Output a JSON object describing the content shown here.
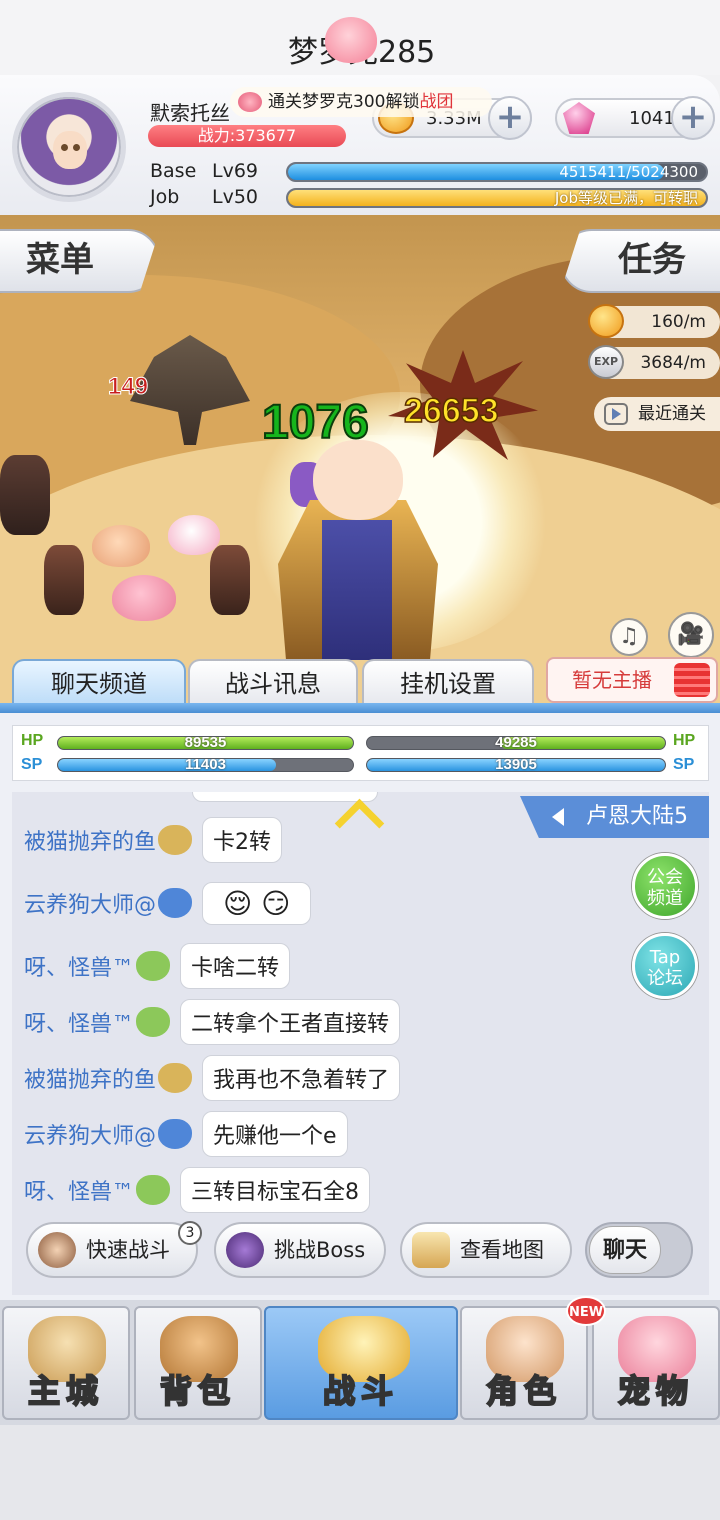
{
  "player": {
    "name": "默索托丝",
    "power": "战力:373677",
    "base_label": "Base",
    "base_level": "Lv69",
    "base_exp": "4515411/5024300",
    "base_exp_fraction": 0.899,
    "job_label": "Job",
    "job_level": "Lv50",
    "job_status": "Job等级已满，可转职",
    "job_exp_fraction": 1.0
  },
  "currency": {
    "zeny": "3.33M",
    "gems": "1041",
    "plus": "+"
  },
  "scene": {
    "menu": "菜单",
    "task": "任务",
    "stage_title": "梦罗克285",
    "unlock_text": "通关梦罗克300解锁",
    "unlock_highlight": "战团",
    "zeny_rate": "160/m",
    "exp_rate": "3684/m",
    "exp_badge": "EXP",
    "recent_clear": "最近通关",
    "damage_player": "1076",
    "damage_crit": "26653",
    "damage_enemy": "149"
  },
  "tabs": [
    {
      "label": "聊天频道",
      "active": true
    },
    {
      "label": "战斗讯息",
      "active": false
    },
    {
      "label": "挂机设置",
      "active": false
    }
  ],
  "broadcast": "暂无主播",
  "stats": {
    "hp_label": "HP",
    "sp_label": "SP",
    "player_hp": "89535",
    "player_hp_fraction": 1.0,
    "player_sp": "11403",
    "player_sp_fraction": 0.74,
    "pet_hp": "49285",
    "pet_hp_fraction": 0.55,
    "pet_sp": "13905",
    "pet_sp_fraction": 1.0
  },
  "chat": {
    "region": "卢恩大陆5",
    "guild_channel": "公会\n频道",
    "tap_forum": "Tap\n论坛",
    "messages": [
      {
        "user": "被猫抛弃的鱼",
        "text": "卡2转",
        "badge_color": "#d9b45a"
      },
      {
        "user": "云养狗大师@",
        "text": "😌  😏",
        "badge_color": "#4f86d8"
      },
      {
        "user": "呀、怪兽™",
        "text": "卡啥二转",
        "badge_color": "#8cc85a"
      },
      {
        "user": "呀、怪兽™",
        "text": "二转拿个王者直接转",
        "badge_color": "#8cc85a"
      },
      {
        "user": "被猫抛弃的鱼",
        "text": "我再也不急着转了",
        "badge_color": "#d9b45a"
      },
      {
        "user": "云养狗大师@",
        "text": "先赚他一个e",
        "badge_color": "#4f86d8"
      },
      {
        "user": "呀、怪兽™",
        "text": "三转目标宝石全8",
        "badge_color": "#8cc85a"
      }
    ]
  },
  "actions": {
    "fast_battle": "快速战斗",
    "fast_battle_count": "3",
    "boss": "挑战Boss",
    "map": "查看地图",
    "chat": "聊天"
  },
  "nav": [
    {
      "label": "主城",
      "active": false
    },
    {
      "label": "背包",
      "active": false
    },
    {
      "label": "战斗",
      "active": true
    },
    {
      "label": "角色",
      "active": false
    },
    {
      "label": "宠物",
      "active": false
    }
  ],
  "new_badge": "NEW"
}
